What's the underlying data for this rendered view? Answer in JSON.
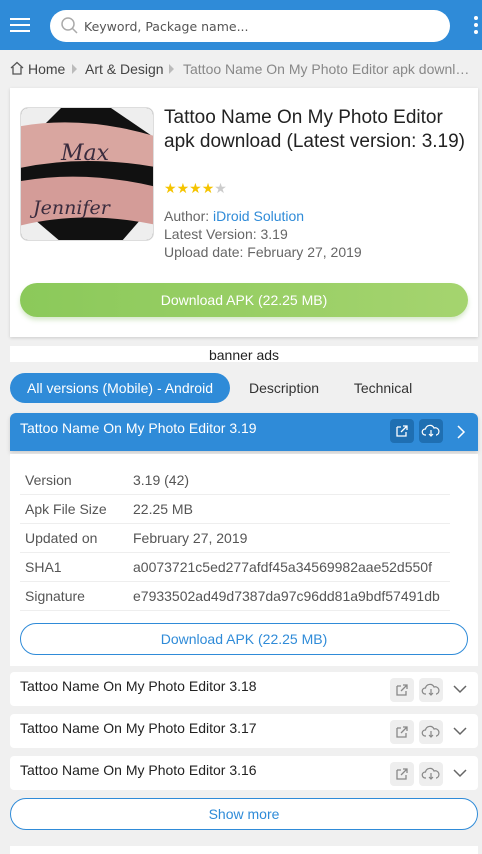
{
  "search": {
    "placeholder": "Keyword, Package name..."
  },
  "breadcrumb": {
    "home": "Home",
    "category": "Art & Design",
    "current": "Tattoo Name On My Photo Editor apk download (Latest version: 3.19)"
  },
  "app": {
    "title": "Tattoo Name On My Photo Editor apk download (Latest version: 3.19)",
    "rating": 4,
    "rating_max": 5,
    "author_label": "Author:",
    "author": "iDroid Solution",
    "latest_version": "Latest Version: 3.19",
    "upload_date": "Upload date: February 27, 2019",
    "download_label": "Download APK (22.25 MB)",
    "icon_text_1": "Max",
    "icon_text_2": "Jennifer"
  },
  "banner": {
    "text": "banner ads"
  },
  "tabs": [
    {
      "label": "All versions (Mobile) - Android",
      "active": true
    },
    {
      "label": "Description",
      "active": false
    },
    {
      "label": "Technical",
      "active": false
    }
  ],
  "versions": [
    {
      "title": "Tattoo Name On My Photo Editor 3.19",
      "expanded": true
    },
    {
      "title": "Tattoo Name On My Photo Editor 3.18",
      "expanded": false
    },
    {
      "title": "Tattoo Name On My Photo Editor 3.17",
      "expanded": false
    },
    {
      "title": "Tattoo Name On My Photo Editor 3.16",
      "expanded": false
    }
  ],
  "version_details": [
    {
      "key": "Version",
      "value": "3.19 (42)"
    },
    {
      "key": "Apk File Size",
      "value": "22.25 MB"
    },
    {
      "key": "Updated on",
      "value": "February 27, 2019"
    },
    {
      "key": "SHA1",
      "value": "a0073721c5ed277afdf45a34569982aae52d550f"
    },
    {
      "key": "Signature",
      "value": "e7933502ad49d7387da97c96dd81a9bdf57491db"
    }
  ],
  "version_download_label": "Download APK (22.25 MB)",
  "show_more_label": "Show more",
  "colors": {
    "accent": "#2f8bd8",
    "download_green": "#8bc95a",
    "star": "#f5c400"
  },
  "icons": [
    "menu-icon",
    "search-icon",
    "more-vert-icon",
    "home-icon",
    "external-link-icon",
    "cloud-download-icon",
    "chevron-right-icon",
    "chevron-down-icon"
  ]
}
